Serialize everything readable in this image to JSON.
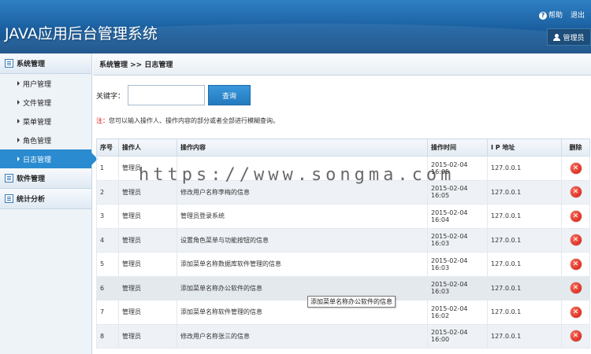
{
  "header": {
    "app_title": "JAVA应用后台管理系统",
    "help_label": "帮助",
    "logout_label": "退出",
    "user_label": "管理员"
  },
  "sidebar": {
    "sections": [
      {
        "label": "系统管理",
        "items": [
          "用户管理",
          "文件管理",
          "菜单管理",
          "角色管理",
          "日志管理"
        ],
        "active": "日志管理"
      },
      {
        "label": "软件管理"
      },
      {
        "label": "统计分析"
      }
    ]
  },
  "main": {
    "breadcrumb": "系统管理 >> 日志管理",
    "search": {
      "label": "关键字：",
      "value": "",
      "placeholder": "",
      "button": "查询"
    },
    "note_prefix": "注：",
    "note_text": "您可以输入操作人、操作内容的部分或者全部进行模糊查询。",
    "table": {
      "columns": [
        "序号",
        "操作人",
        "操作内容",
        "操作时间",
        "I P 地址",
        "删除"
      ],
      "rows": [
        [
          "1",
          "管理员",
          "",
          "2015-02-04 16:05",
          "127.0.0.1"
        ],
        [
          "2",
          "管理员",
          "修改用户名称李梅的信息",
          "2015-02-04 16:05",
          "127.0.0.1"
        ],
        [
          "3",
          "管理员",
          "管理员登录系统",
          "2015-02-04 16:04",
          "127.0.0.1"
        ],
        [
          "4",
          "管理员",
          "设置角色菜单与功能按钮的信息",
          "2015-02-04 16:03",
          "127.0.0.1"
        ],
        [
          "5",
          "管理员",
          "添加菜单名称数据库软件管理的信息",
          "2015-02-04 16:03",
          "127.0.0.1"
        ],
        [
          "6",
          "管理员",
          "添加菜单名称办公软件的信息",
          "2015-02-04 16:03",
          "127.0.0.1"
        ],
        [
          "7",
          "管理员",
          "添加菜单名称软件管理的信息",
          "2015-02-04 16:02",
          "127.0.0.1"
        ],
        [
          "8",
          "管理员",
          "修改用户名称张三的信息",
          "2015-02-04 16:00",
          "127.0.0.1"
        ]
      ]
    },
    "tooltip": "添加菜单名称办公软件的信息"
  },
  "watermark": "https://www.songma.com",
  "colors": {
    "header": "#1a5f9f",
    "active_menu": "#2a8bd0",
    "button": "#2479bd",
    "delete": "#c81b0e",
    "note": "#d40000"
  },
  "icons": {
    "help": "help-icon",
    "user": "user-icon",
    "menu": "list-icon",
    "delete": "delete-icon"
  }
}
